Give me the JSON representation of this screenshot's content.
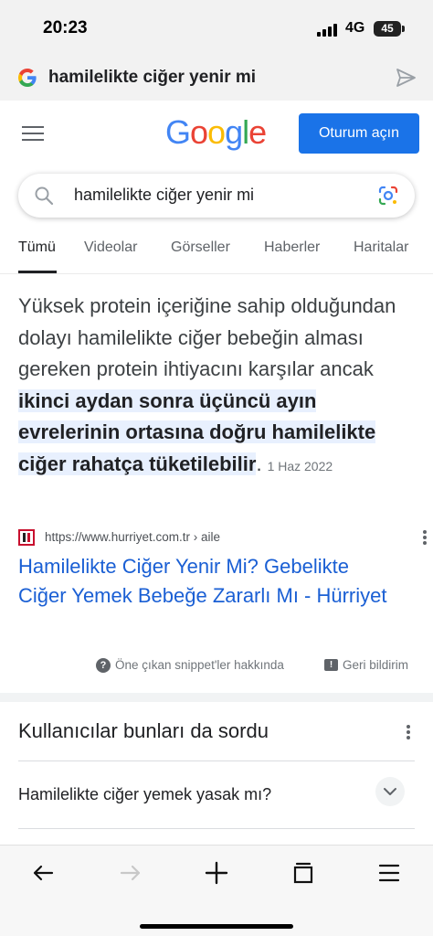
{
  "status_bar": {
    "time": "20:23",
    "network": "4G",
    "battery": "45"
  },
  "address_bar": {
    "query": "hamilelikte ciğer yenir mi",
    "icons": [
      "google-g-icon",
      "send-icon"
    ]
  },
  "header": {
    "logo_letters": [
      "G",
      "o",
      "o",
      "g",
      "l",
      "e"
    ],
    "logo_colors": [
      "#4285f4",
      "#ea4335",
      "#fbbc05",
      "#4285f4",
      "#34a853",
      "#ea4335"
    ],
    "signin_label": "Oturum açın"
  },
  "search": {
    "value": "hamilelikte ciğer yenir mi"
  },
  "tabs": [
    "Tümü",
    "Videolar",
    "Görseller",
    "Haberler",
    "Haritalar"
  ],
  "snippet": {
    "text_plain": "Yüksek protein içeriğine sahip olduğundan dolayı hamilelikte ciğer bebeğin alması gereken protein ihtiyacını karşılar ancak ",
    "text_bold": "ikinci aydan sonra üçüncü ayın evrelerinin ortasına doğru hamilelikte ciğer rahatça tüketilebilir",
    "text_end": ".",
    "date": "1 Haz 2022",
    "source_url": "https://www.hurriyet.com.tr › aile",
    "result_title": "Hamilelikte Ciğer Yenir Mi? Gebelikte Ciğer Yemek Bebeğe Zararlı Mı - Hürriyet",
    "about_label": "Öne çıkan snippet'ler hakkında",
    "feedback_label": "Geri bildirim"
  },
  "people_also_ask": {
    "title": "Kullanıcılar bunları da sordu",
    "questions": [
      "Hamilelikte ciğer yemek yasak mı?"
    ]
  },
  "colors": {
    "accent": "#1a73e8",
    "link": "#1a5fd4",
    "highlight": "#e8f0fe"
  }
}
